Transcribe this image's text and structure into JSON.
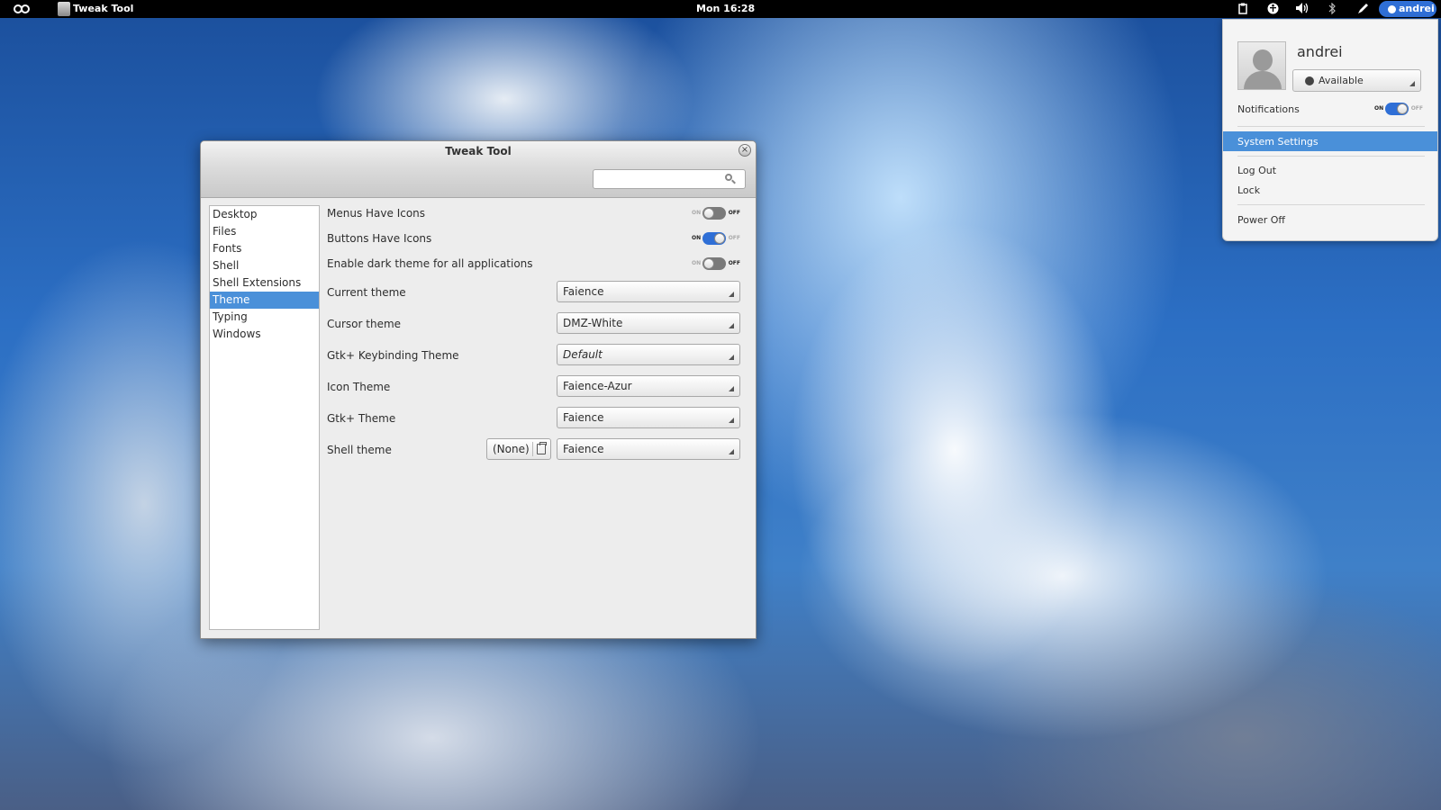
{
  "top_panel": {
    "app_title": "Tweak Tool",
    "clock": "Mon 16:28",
    "user_name": "andrei",
    "tray_icons": [
      "clipboard-icon",
      "accessibility-icon",
      "volume-icon",
      "bluetooth-icon",
      "pen-icon"
    ]
  },
  "user_menu": {
    "name": "andrei",
    "status": "Available",
    "notifications_label": "Notifications",
    "notifications_on": true,
    "switch_on_label": "ON",
    "switch_off_label": "OFF",
    "items": {
      "system_settings": "System Settings",
      "log_out": "Log Out",
      "lock": "Lock",
      "power_off": "Power Off"
    }
  },
  "window": {
    "title": "Tweak Tool",
    "search_value": "",
    "sidebar": {
      "items": [
        "Desktop",
        "Files",
        "Fonts",
        "Shell",
        "Shell Extensions",
        "Theme",
        "Typing",
        "Windows"
      ],
      "selected": "Theme"
    },
    "switches": [
      {
        "label": "Menus Have Icons",
        "on": false
      },
      {
        "label": "Buttons Have Icons",
        "on": true
      },
      {
        "label": "Enable dark theme for all applications",
        "on": false
      }
    ],
    "combos": [
      {
        "label": "Current theme",
        "value": "Faience"
      },
      {
        "label": "Cursor theme",
        "value": "DMZ-White"
      },
      {
        "label": "Gtk+ Keybinding Theme",
        "value": "Default"
      },
      {
        "label": "Icon Theme",
        "value": "Faience-Azur"
      },
      {
        "label": "Gtk+ Theme",
        "value": "Faience"
      },
      {
        "label": "Shell theme",
        "value": "Faience"
      }
    ],
    "shell_theme_file": "(None)"
  },
  "colors": {
    "accent": "#4a90d9",
    "switch_on": "#2f6fd6",
    "panel": "#000000"
  }
}
